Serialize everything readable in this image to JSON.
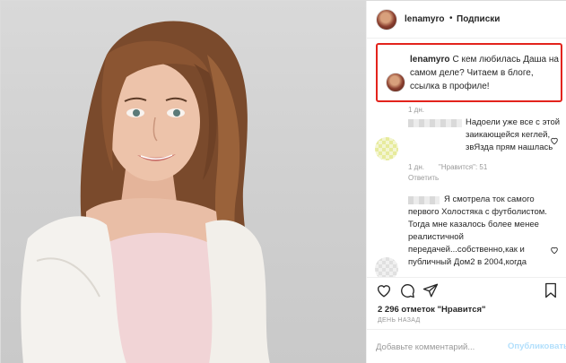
{
  "post_header": {
    "username": "lenamyro",
    "separator": "•",
    "follow_label": "Подписки"
  },
  "caption": {
    "username": "lenamyro",
    "text": "С кем любилась Даша на самом деле? Читаем в блоге, ссылка в профиле!",
    "time": "1 дн."
  },
  "comments": [
    {
      "text": "Надоели уже все с этой заикающейся кеглей, звЯзда прям нашлась",
      "time": "1 дн.",
      "likes": "\"Нравится\": 51",
      "reply": "Ответить"
    },
    {
      "text": "Я смотрела ток самого первого Холостяка с футболистом. Тогда мне казалось более менее реалистичной передачей...собственно,как и публичный Дом2 в 2004,когда"
    }
  ],
  "actions": {
    "like_icon": "heart-icon",
    "comment_icon": "comment-icon",
    "share_icon": "share-icon",
    "save_icon": "bookmark-icon"
  },
  "likes_text": "2 296 отметок \"Нравится\"",
  "posted_ago": "ДЕНЬ НАЗАД",
  "add_comment": {
    "placeholder": "Добавьте комментарий...",
    "publish_label": "Опубликовать"
  },
  "colors": {
    "highlight_border": "#e3231c",
    "publish_disabled": "#b2dffc",
    "meta_gray": "#999999"
  }
}
